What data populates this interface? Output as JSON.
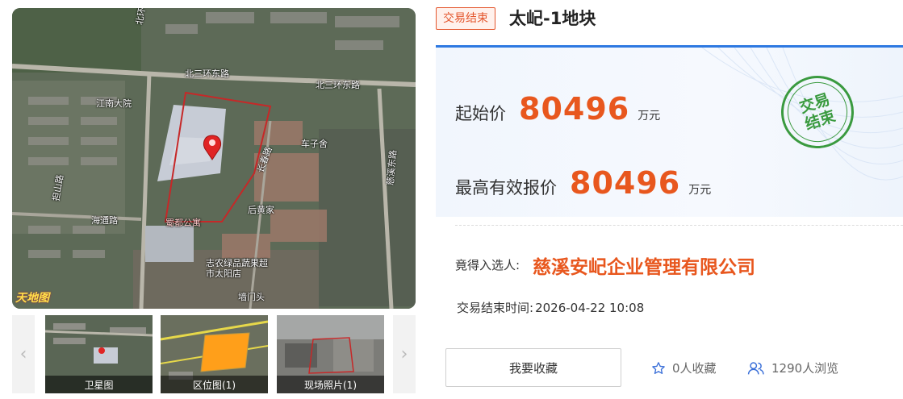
{
  "map": {
    "labels": {
      "road_north_east": "北三环东路",
      "road_north_east_2": "北三环东路",
      "community_jiangnan": "江南大院",
      "village_chezi": "车子舍",
      "village_houhuang": "后黄家",
      "road_haitong": "海通路",
      "road_changjiang": "长春路",
      "road_west": "担山路",
      "road_east": "慈溪东路",
      "community_shudu": "蜀都公寓",
      "store": "志农绿品蔬果超市太阳店",
      "village_qiangmen": "墙门头",
      "road_top": "北环"
    },
    "watermark": "天地图",
    "pin_color": "#e02424",
    "parcel_outline_color": "#c62828"
  },
  "thumbnails": {
    "prev_icon": "chevron-left-icon",
    "next_icon": "chevron-right-icon",
    "items": [
      {
        "caption": "卫星图"
      },
      {
        "caption": "区位图(1)"
      },
      {
        "caption": "现场照片(1)"
      }
    ]
  },
  "header": {
    "status_tag": "交易结束",
    "title": "太屺-1地块"
  },
  "price_card": {
    "start_price_label": "起始价",
    "start_price_value": "80496",
    "start_price_unit": "万元",
    "highest_bid_label": "最高有效报价",
    "highest_bid_value": "80496",
    "highest_bid_unit": "万元",
    "stamp_text": "交易结束",
    "accent_color": "#2e79e1",
    "value_color": "#e8571e",
    "stamp_color": "#3a9a3f"
  },
  "result": {
    "winner_label": "竟得入选人:",
    "winner_name": "慈溪安屺企业管理有限公司",
    "end_time_label": "交易结束时间:",
    "end_time_value": "2026-04-22 10:08"
  },
  "actions": {
    "favorite_button": "我要收藏",
    "favorites_count": "0人收藏",
    "views_count": "1290人浏览"
  }
}
